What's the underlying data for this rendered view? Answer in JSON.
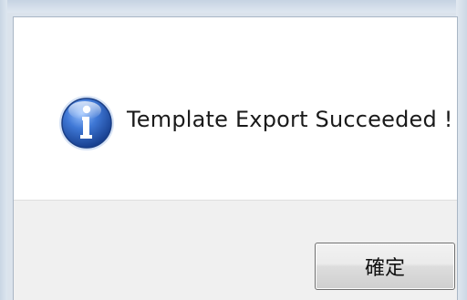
{
  "dialog": {
    "message": "Template Export Succeeded !",
    "icon": "information-icon",
    "ok_label": "確定"
  },
  "colors": {
    "icon_blue": "#2a5fb8",
    "footer_background": "#f0f0f0",
    "content_background": "#ffffff"
  }
}
